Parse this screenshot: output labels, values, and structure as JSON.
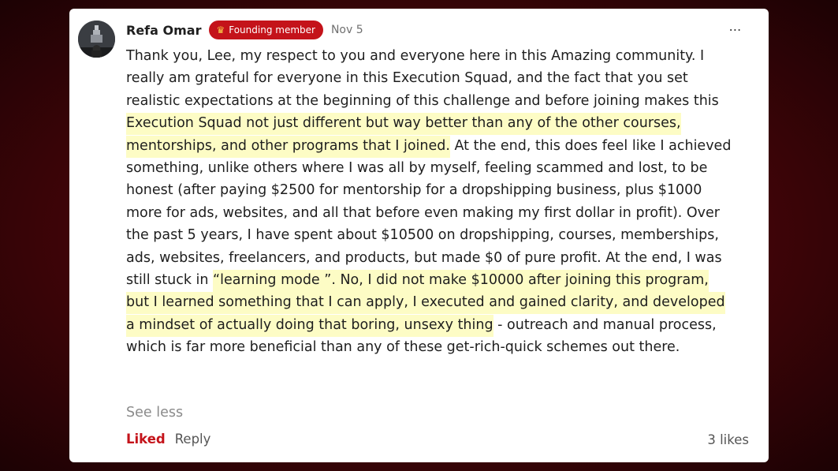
{
  "comment": {
    "author": "Refa Omar",
    "badge_label": "Founding member",
    "badge_icon": "crown-icon",
    "date": "Nov 5",
    "more_icon": "⋯",
    "body": {
      "p1": "Thank you, Lee, my respect to you and everyone here in this Amazing community. I really am grateful for everyone in this Execution Squad, and the fact that you set realistic expectations at the beginning of this challenge and before joining makes this ",
      "h1": "Execution Squad not just different but way better than any of the other courses, mentorships, and other programs that I joined.",
      "p2": " At the end, this does feel like I achieved something, unlike others where I was all by myself, feeling scammed and lost, to be honest (after paying $2500 for mentorship for a dropshipping business, plus $1000 more for ads, websites, and all that before even making my first dollar in profit). Over the past 5 years, I have spent about $10500 on dropshipping, courses, memberships, ads, websites, freelancers, and products, but made $0 of pure profit. At the end, I was still stuck in ",
      "h2": "“learning mode ”.  No, I did not make $10000 after joining this program, but I learned something that I can apply, I executed and gained clarity, and developed a mindset of actually doing that boring, unsexy thing",
      "p3": " - outreach and manual process, which is far more beneficial than any of these get-rich-quick schemes out there."
    },
    "see_less": "See less",
    "liked_label": "Liked",
    "reply_label": "Reply",
    "likes_count": "3 likes"
  },
  "colors": {
    "accent": "#c4131a",
    "highlight": "#fdfcc5",
    "background": "#4a0509"
  }
}
